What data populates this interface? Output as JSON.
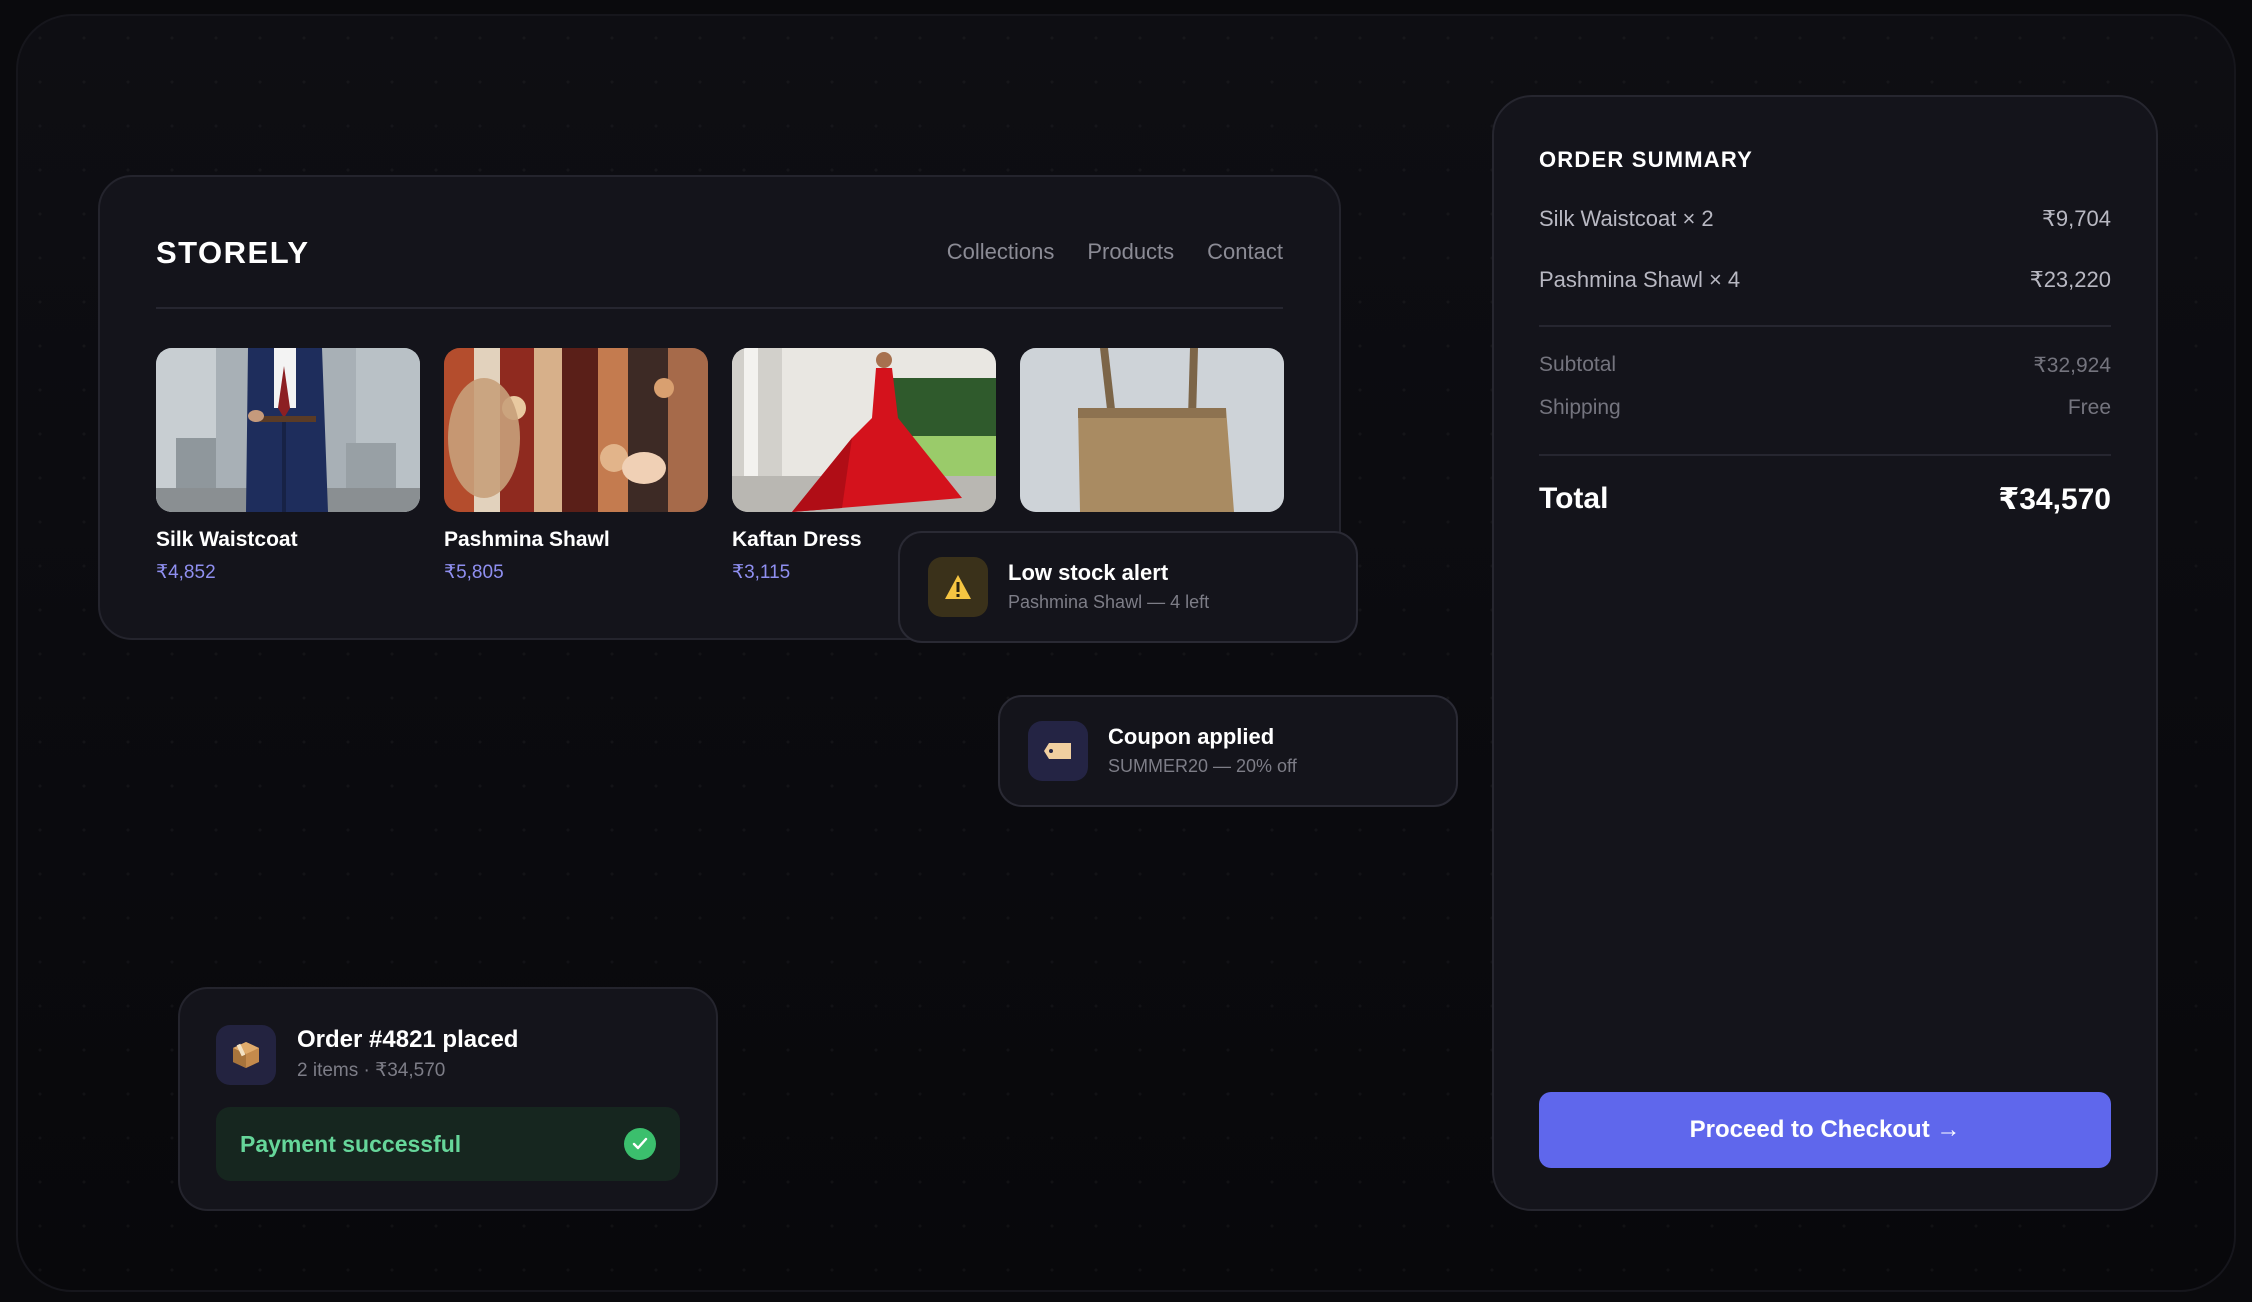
{
  "store": {
    "brand": "STORELY",
    "nav": [
      "Collections",
      "Products",
      "Contact"
    ],
    "products": [
      {
        "name": "Silk Waistcoat",
        "price": "₹4,852",
        "image": "man-in-navy-suit"
      },
      {
        "name": "Pashmina Shawl",
        "price": "₹5,805",
        "image": "patterned-shawls-rack"
      },
      {
        "name": "Kaftan Dress",
        "price": "₹3,115",
        "image": "woman-in-red-dress"
      },
      {
        "name": "",
        "price": "",
        "image": "tan-tote-bag"
      }
    ]
  },
  "notifications": {
    "low_stock": {
      "title": "Low stock alert",
      "subtitle": "Pashmina Shawl — 4 left",
      "icon": "warning-icon"
    },
    "coupon": {
      "title": "Coupon applied",
      "subtitle": "SUMMER20 — 20% off",
      "icon": "tag-icon"
    }
  },
  "order": {
    "title": "Order #4821 placed",
    "subtitle": "2 items · ₹34,570",
    "icon": "package-icon",
    "payment_label": "Payment successful"
  },
  "summary": {
    "title": "ORDER SUMMARY",
    "items": [
      {
        "label": "Silk Waistcoat × 2",
        "amount": "₹9,704"
      },
      {
        "label": "Pashmina Shawl × 4",
        "amount": "₹23,220"
      }
    ],
    "subtotal_label": "Subtotal",
    "subtotal": "₹32,924",
    "shipping_label": "Shipping",
    "shipping": "Free",
    "total_label": "Total",
    "total": "₹34,570",
    "checkout_label": "Proceed to Checkout →"
  },
  "colors": {
    "accent": "#5f67ec",
    "price": "#8f8ff0",
    "success": "#66d69a",
    "warning": "#f5c542",
    "background": "#0a0a0d",
    "card": "#14141b"
  }
}
